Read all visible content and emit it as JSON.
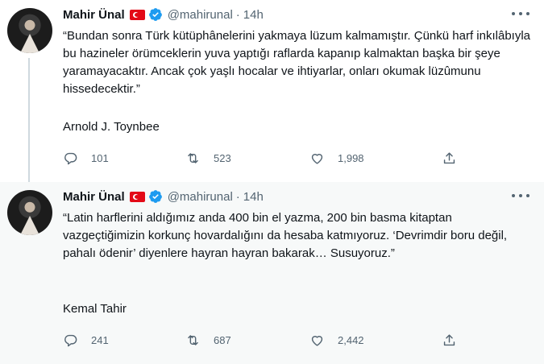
{
  "tweets": [
    {
      "author": {
        "name": "Mahir Ünal",
        "handle": "@mahirunal",
        "time": "14h"
      },
      "text": "“Bundan sonra Türk kütüphânelerini yakmaya lüzum kalmamıştır. Çünkü harf inkılâbıyla bu hazineler örümceklerin yuva yaptığı raflarda kapanıp kalmaktan başka bir şeye yaramayacaktır. Ancak çok yaşlı hocalar ve ihtiyarlar, onları okumak lüzûmunu hissedecektir.”",
      "attribution": "Arnold J. Toynbee",
      "counts": {
        "replies": "101",
        "retweets": "523",
        "likes": "1,998"
      }
    },
    {
      "author": {
        "name": "Mahir Ünal",
        "handle": "@mahirunal",
        "time": "14h"
      },
      "text": "“Latin harflerini aldığımız anda 400 bin el yazma, 200 bin basma kitaptan vazgeçtiğimizin korkunç hovardalığını da hesaba katmıyoruz. ‘Devrimdir boru değil,\npahalı ödenir’ diyenlere hayran hayran bakarak… Susuyoruz.”",
      "attribution": "Kemal Tahir",
      "counts": {
        "replies": "241",
        "retweets": "687",
        "likes": "2,442"
      }
    }
  ],
  "separator": "·",
  "icons": {
    "flag": "turkey-flag-icon",
    "verified": "verified-badge-icon",
    "more": "more-options-icon",
    "reply": "reply-icon",
    "retweet": "retweet-icon",
    "like": "like-icon",
    "share": "share-icon"
  },
  "colors": {
    "verified": "#1d9bf0",
    "secondary_text": "#536471",
    "thread_line": "#cfd9de",
    "flag_red": "#e30a17"
  }
}
